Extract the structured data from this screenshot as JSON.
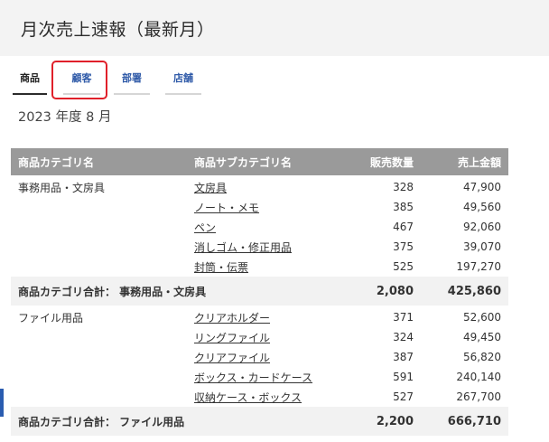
{
  "header": {
    "title": "月次売上速報（最新月）"
  },
  "tabs": [
    {
      "label": "商品",
      "active": true
    },
    {
      "label": "顧客",
      "active": false
    },
    {
      "label": "部署",
      "active": false
    },
    {
      "label": "店舗",
      "active": false
    }
  ],
  "period": "2023 年度 8 月",
  "table": {
    "columns": [
      "商品カテゴリ名",
      "商品サブカテゴリ名",
      "販売数量",
      "売上金額"
    ],
    "groups": [
      {
        "category": "事務用品・文房具",
        "rows": [
          {
            "sub": "文房具",
            "qty": "328",
            "amount": "47,900"
          },
          {
            "sub": "ノート・メモ",
            "qty": "385",
            "amount": "49,560"
          },
          {
            "sub": "ペン",
            "qty": "467",
            "amount": "92,060"
          },
          {
            "sub": "消しゴム・修正用品",
            "qty": "375",
            "amount": "39,070"
          },
          {
            "sub": "封筒・伝票",
            "qty": "525",
            "amount": "197,270"
          }
        ],
        "subtotal": {
          "label": "商品カテゴリ合計： 事務用品・文房具",
          "qty": "2,080",
          "amount": "425,860"
        }
      },
      {
        "category": "ファイル用品",
        "rows": [
          {
            "sub": "クリアホルダー",
            "qty": "371",
            "amount": "52,600"
          },
          {
            "sub": "リングファイル",
            "qty": "324",
            "amount": "49,450"
          },
          {
            "sub": "クリアファイル",
            "qty": "387",
            "amount": "56,820"
          },
          {
            "sub": "ボックス・カードケース",
            "qty": "591",
            "amount": "240,140"
          },
          {
            "sub": "収納ケース・ボックス",
            "qty": "527",
            "amount": "267,700"
          }
        ],
        "subtotal": {
          "label": "商品カテゴリ合計： ファイル用品",
          "qty": "2,200",
          "amount": "666,710"
        }
      }
    ]
  },
  "colors": {
    "tab_link": "#2f5aa8",
    "header_bg": "#9a9a9a",
    "highlight": "#e0202a"
  }
}
